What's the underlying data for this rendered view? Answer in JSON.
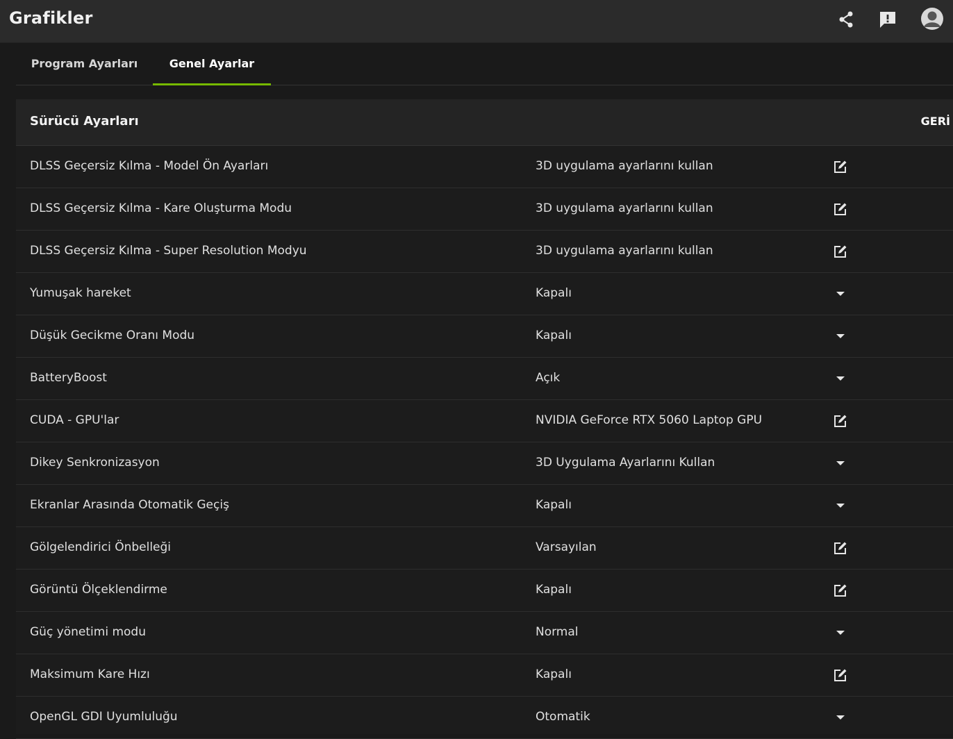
{
  "app": {
    "title": "Grafikler"
  },
  "titlebar_icons": [
    {
      "icon": "share-icon"
    },
    {
      "icon": "feedback-icon"
    },
    {
      "icon": "avatar-icon"
    }
  ],
  "tabs": [
    {
      "label": "Program Ayarları",
      "active": false
    },
    {
      "label": "Genel Ayarlar",
      "active": true
    }
  ],
  "section": {
    "title": "Sürücü Ayarları",
    "action_label": "GERİ"
  },
  "settings": [
    {
      "label": "DLSS Geçersiz Kılma - Model Ön Ayarları",
      "value": "3D uygulama ayarlarını kullan",
      "control": "edit"
    },
    {
      "label": "DLSS Geçersiz Kılma - Kare Oluşturma Modu",
      "value": "3D uygulama ayarlarını kullan",
      "control": "edit"
    },
    {
      "label": "DLSS Geçersiz Kılma - Super Resolution Modyu",
      "value": "3D uygulama ayarlarını kullan",
      "control": "edit"
    },
    {
      "label": "Yumuşak hareket",
      "value": "Kapalı",
      "control": "dropdown"
    },
    {
      "label": "Düşük Gecikme Oranı Modu",
      "value": "Kapalı",
      "control": "dropdown"
    },
    {
      "label": "BatteryBoost",
      "value": "Açık",
      "control": "dropdown"
    },
    {
      "label": "CUDA - GPU'lar",
      "value": "NVIDIA GeForce RTX 5060 Laptop GPU",
      "control": "edit"
    },
    {
      "label": "Dikey Senkronizasyon",
      "value": "3D Uygulama Ayarlarını Kullan",
      "control": "dropdown"
    },
    {
      "label": "Ekranlar Arasında Otomatik Geçiş",
      "value": "Kapalı",
      "control": "dropdown"
    },
    {
      "label": "Gölgelendirici Önbelleği",
      "value": "Varsayılan",
      "control": "edit"
    },
    {
      "label": "Görüntü Ölçeklendirme",
      "value": "Kapalı",
      "control": "edit"
    },
    {
      "label": "Güç yönetimi modu",
      "value": "Normal",
      "control": "dropdown"
    },
    {
      "label": "Maksimum Kare Hızı",
      "value": "Kapalı",
      "control": "edit"
    },
    {
      "label": "OpenGL GDI Uyumluluğu",
      "value": "Otomatik",
      "control": "dropdown"
    }
  ],
  "colors": {
    "accent": "#76b900",
    "background": "#1a1a1a",
    "titlebar": "#2b2b2b"
  }
}
